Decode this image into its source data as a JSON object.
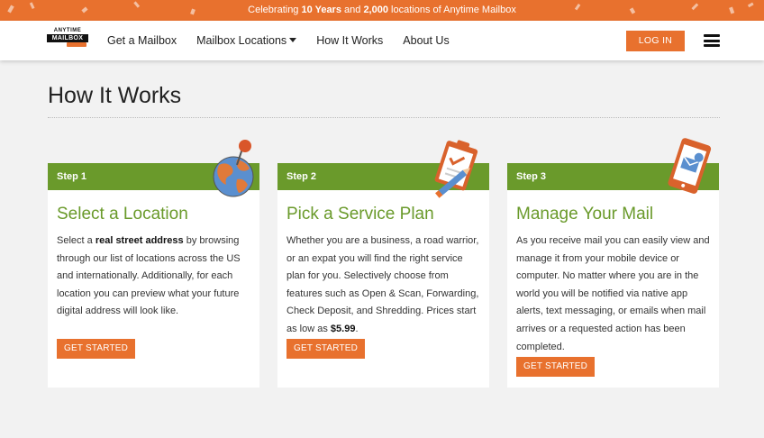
{
  "promo": {
    "prefix": "Celebrating ",
    "years": "10 Years",
    "mid": " and ",
    "locations": "2,000",
    "suffix": " locations of Anytime Mailbox"
  },
  "logo": {
    "line1": "ANYTIME",
    "line2": "MAILBOX"
  },
  "nav": {
    "links": [
      "Get a Mailbox",
      "Mailbox Locations",
      "How It Works",
      "About Us"
    ],
    "login": "LOG IN"
  },
  "page": {
    "title": "How It Works"
  },
  "steps": [
    {
      "label": "Step 1",
      "title": "Select a Location",
      "text_pre": "Select a ",
      "text_bold": "real street address",
      "text_post": " by browsing through our list of locations across the US and internationally. Additionally, for each location you can preview what your future digital address will look like.",
      "cta": "GET STARTED"
    },
    {
      "label": "Step 2",
      "title": "Pick a Service Plan",
      "text_pre": "Whether you are a business, a road warrior, or an expat you will find the right service plan for you. Selectively choose from features such as Open & Scan, Forwarding, Check Deposit, and Shredding. Prices start as low as ",
      "text_bold": "$5.99",
      "text_post": ".",
      "cta": "GET STARTED"
    },
    {
      "label": "Step 3",
      "title": "Manage Your Mail",
      "text_pre": "As you receive mail you can easily view and manage it from your mobile device or computer. No matter where you are in the world you will be notified via native app alerts, text messaging, or emails when mail arrives or a requested action has been completed.",
      "text_bold": "",
      "text_post": "",
      "cta": "GET STARTED"
    }
  ],
  "colors": {
    "orange": "#e8712e",
    "green": "#6a9a2b",
    "background": "#f2f2f2"
  },
  "icons": [
    "globe-pin-icon",
    "clipboard-pencil-icon",
    "tablet-mail-icon",
    "menu-icon"
  ]
}
